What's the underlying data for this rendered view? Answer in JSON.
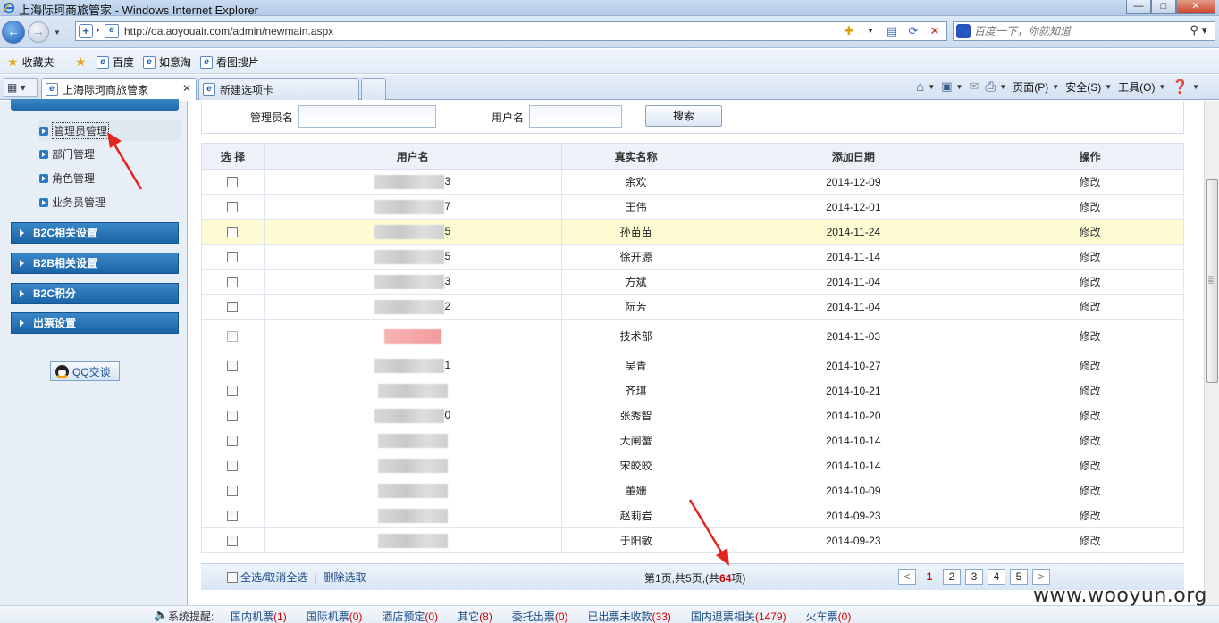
{
  "window": {
    "title": "上海际珂商旅管家 - Windows Internet Explorer",
    "buttons": {
      "min": "—",
      "max": "□",
      "close": "✕"
    }
  },
  "address": {
    "url": "http://oa.aoyouair.com/admin/newmain.aspx",
    "search_placeholder": "百度一下，你就知道"
  },
  "favorites": {
    "label": "收藏夹",
    "items": [
      "百度",
      "如意淘",
      "看图搜片"
    ]
  },
  "tabs": {
    "active": "上海际珂商旅管家",
    "new": "新建选项卡"
  },
  "commandbar": {
    "page": "页面(P)",
    "safety": "安全(S)",
    "tools": "工具(O)"
  },
  "sidebar": {
    "sub_items": [
      "管理员管理",
      "部门管理",
      "角色管理",
      "业务员管理"
    ],
    "groups": [
      "B2C相关设置",
      "B2B相关设置",
      "B2C积分",
      "出票设置"
    ],
    "qq_button": "QQ交谈"
  },
  "search_form": {
    "admin_label": "管理员名",
    "user_label": "用户名",
    "search_button": "搜索"
  },
  "table": {
    "headers": [
      "选 择",
      "用户名",
      "真实名称",
      "添加日期",
      "操作"
    ],
    "edit_label": "修改",
    "rows": [
      {
        "user_suffix": "3",
        "real_name": "余欢",
        "date": "2014-12-09"
      },
      {
        "user_suffix": "7",
        "real_name": "王伟",
        "date": "2014-12-01"
      },
      {
        "user_suffix": "5",
        "real_name": "孙苗苗",
        "date": "2014-11-24"
      },
      {
        "user_suffix": "5",
        "real_name": "徐开源",
        "date": "2014-11-14"
      },
      {
        "user_suffix": "3",
        "real_name": "方斌",
        "date": "2014-11-04"
      },
      {
        "user_suffix": "2",
        "real_name": "阮芳",
        "date": "2014-11-04"
      },
      {
        "user_suffix": "",
        "real_name": "技术部",
        "date": "2014-11-03"
      },
      {
        "user_suffix": "1",
        "real_name": "吴青",
        "date": "2014-10-27"
      },
      {
        "user_suffix": "",
        "real_name": "齐琪",
        "date": "2014-10-21"
      },
      {
        "user_suffix": "0",
        "real_name": "张秀智",
        "date": "2014-10-20"
      },
      {
        "user_suffix": "",
        "real_name": "大闸蟹",
        "date": "2014-10-14"
      },
      {
        "user_suffix": "",
        "real_name": "宋皎皎",
        "date": "2014-10-14"
      },
      {
        "user_suffix": "",
        "real_name": "董姗",
        "date": "2014-10-09"
      },
      {
        "user_suffix": "",
        "real_name": "赵莉岩",
        "date": "2014-09-23"
      },
      {
        "user_suffix": "",
        "real_name": "于阳敏",
        "date": "2014-09-23"
      }
    ]
  },
  "footer": {
    "select_all": "全选/取消全选",
    "delete_selected": "删除选取",
    "page_info_pre": "第1页,共5页,(共",
    "total": "64",
    "page_info_post": "项)",
    "pages": [
      "<",
      "1",
      "2",
      "3",
      "4",
      "5",
      ">"
    ]
  },
  "status": {
    "lead": "系统提醒:",
    "items": [
      {
        "label": "国内机票",
        "count": "1"
      },
      {
        "label": "国际机票",
        "count": "0"
      },
      {
        "label": "酒店预定",
        "count": "0"
      },
      {
        "label": "其它",
        "count": "8"
      },
      {
        "label": "委托出票",
        "count": "0"
      },
      {
        "label": "已出票未收款",
        "count": "33"
      },
      {
        "label": "国内退票相关",
        "count": "1479"
      },
      {
        "label": "火车票",
        "count": "0"
      }
    ]
  },
  "watermark": "www.wooyun.org"
}
